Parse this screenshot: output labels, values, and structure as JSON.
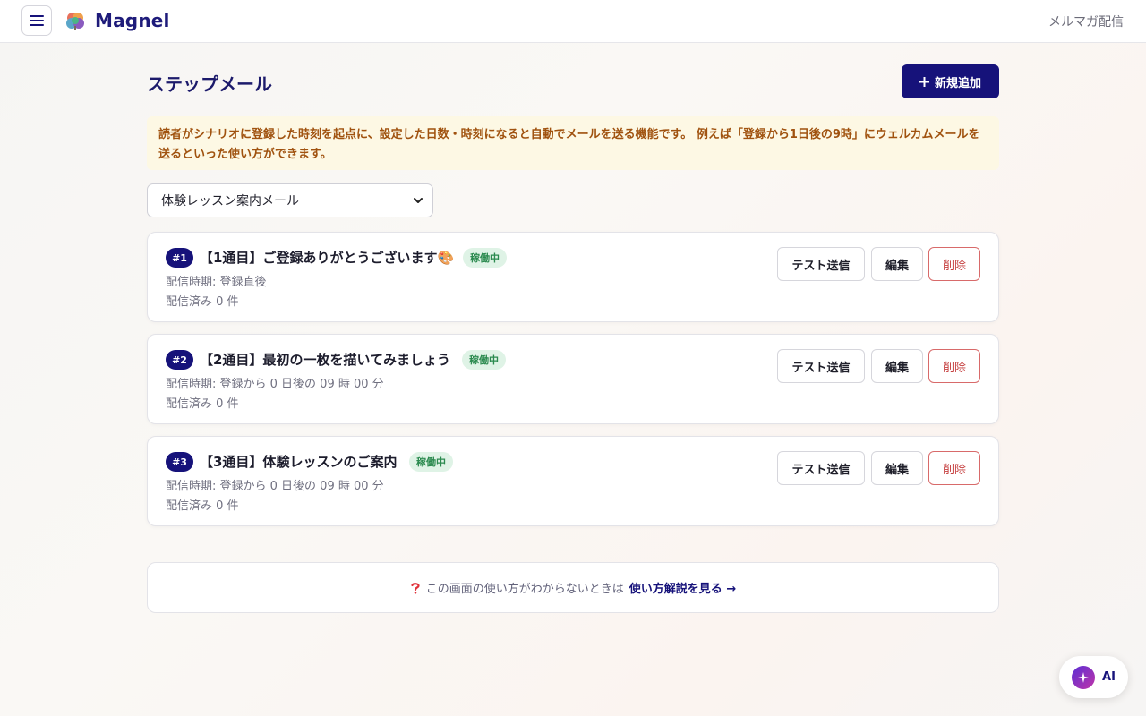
{
  "header": {
    "app_name": "Magnel",
    "right_label": "メルマガ配信"
  },
  "page": {
    "title": "ステップメール",
    "add_button": "新規追加",
    "notice": "読者がシナリオに登録した時刻を起点に、設定した日数・時刻になると自動でメールを送る機能です。 例えば「登録から1日後の9時」にウェルカムメールを送るといった使い方ができます。",
    "scenario_select": "体験レッスン案内メール"
  },
  "steps": [
    {
      "number": "#1",
      "title": "【1通目】ご登録ありがとうございます🎨",
      "status": "稼働中",
      "timing": "配信時期: 登録直後",
      "sent": "配信済み 0 件"
    },
    {
      "number": "#2",
      "title": "【2通目】最初の一枚を描いてみましょう",
      "status": "稼働中",
      "timing": "配信時期: 登録から 0 日後の 09 時 00 分",
      "sent": "配信済み 0 件"
    },
    {
      "number": "#3",
      "title": "【3通目】体験レッスンのご案内",
      "status": "稼働中",
      "timing": "配信時期: 登録から 0 日後の 09 時 00 分",
      "sent": "配信済み 0 件"
    }
  ],
  "actions": {
    "test_send": "テスト送信",
    "edit": "編集",
    "delete": "削除"
  },
  "help": {
    "text": "この画面の使い方がわからないときは",
    "link": "使い方解説を見る →"
  },
  "ai_button": {
    "label": "AI"
  },
  "colors": {
    "primary": "#16127a",
    "notice_bg": "#fdf8e4",
    "notice_text": "#a0520f",
    "status_bg": "#dff3e6",
    "status_text": "#2b8a4f",
    "delete": "#c64040"
  }
}
